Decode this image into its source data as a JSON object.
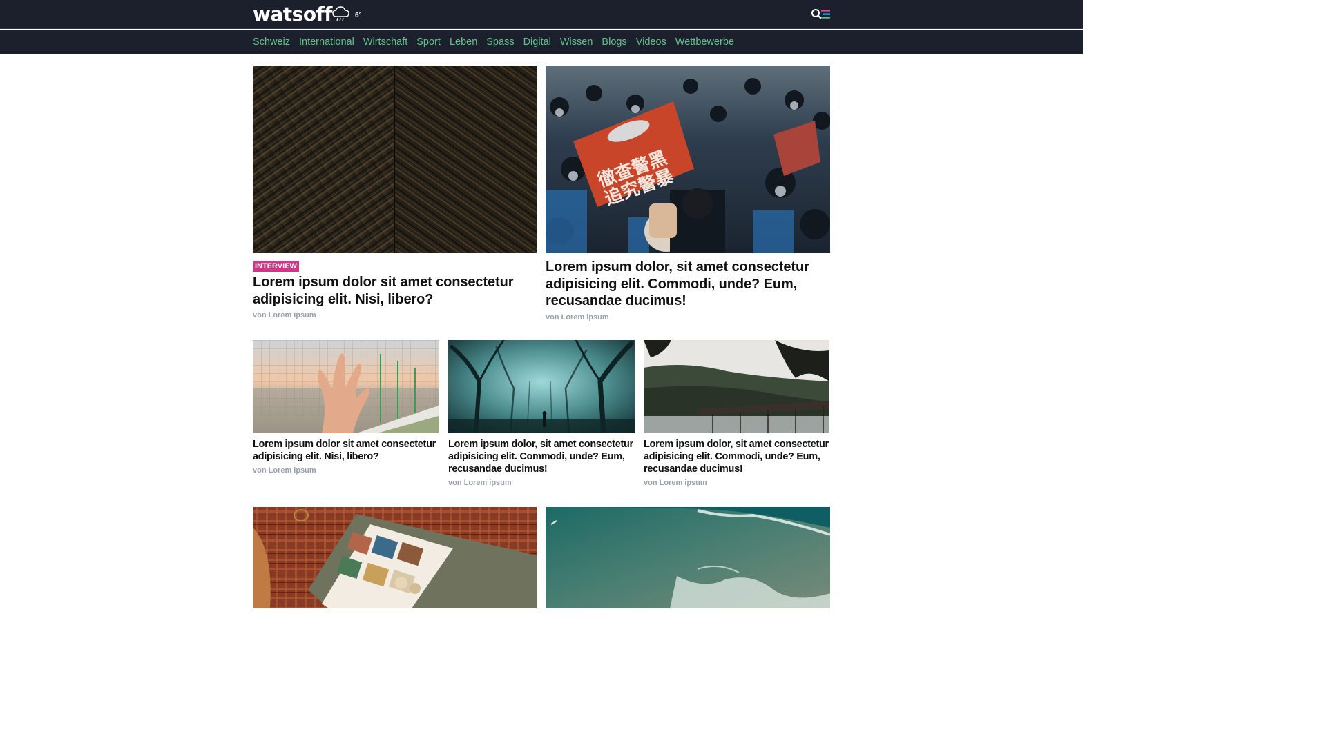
{
  "header": {
    "logo": "watsoff",
    "weather": {
      "icon": "rain-cloud-icon",
      "temperature": "6°"
    },
    "menu_icon": "search-menu-icon"
  },
  "nav": {
    "items": [
      "Schweiz",
      "International",
      "Wirtschaft",
      "Sport",
      "Leben",
      "Spass",
      "Digital",
      "Wissen",
      "Blogs",
      "Videos",
      "Wettbewerbe"
    ]
  },
  "colors": {
    "header_bg": "#1b202c",
    "nav_link": "#5fc48a",
    "tag_bg": "#d6338a",
    "byline": "#9aa0ad"
  },
  "articles": [
    {
      "tag": "INTERVIEW",
      "title": "Lorem ipsum dolor sit amet consectetur adipisicing elit. Nisi, libero?",
      "byline": "von Lorem ipsum",
      "image": "wood-planks-photo"
    },
    {
      "title": "Lorem ipsum dolor, sit amet consectetur adipisicing elit. Commodi, unde? Eum, recusandae ducimus!",
      "byline": "von Lorem ipsum",
      "image": "protest-crowd-photo"
    },
    {
      "title": "Lorem ipsum dolor sit amet consectetur adipisicing elit. Nisi, libero?",
      "byline": "von Lorem ipsum",
      "image": "hand-fence-sea-photo"
    },
    {
      "title": "Lorem ipsum dolor, sit amet consectetur adipisicing elit. Commodi, unde? Eum, recusandae ducimus!",
      "byline": "von Lorem ipsum",
      "image": "foggy-forest-photo"
    },
    {
      "title": "Lorem ipsum dolor, sit amet consectetur adipisicing elit. Commodi, unde? Eum, recusandae ducimus!",
      "byline": "von Lorem ipsum",
      "image": "bridge-forest-photo"
    },
    {
      "image": "magazine-tablecloth-photo"
    },
    {
      "image": "ocean-waves-aerial-photo"
    }
  ]
}
